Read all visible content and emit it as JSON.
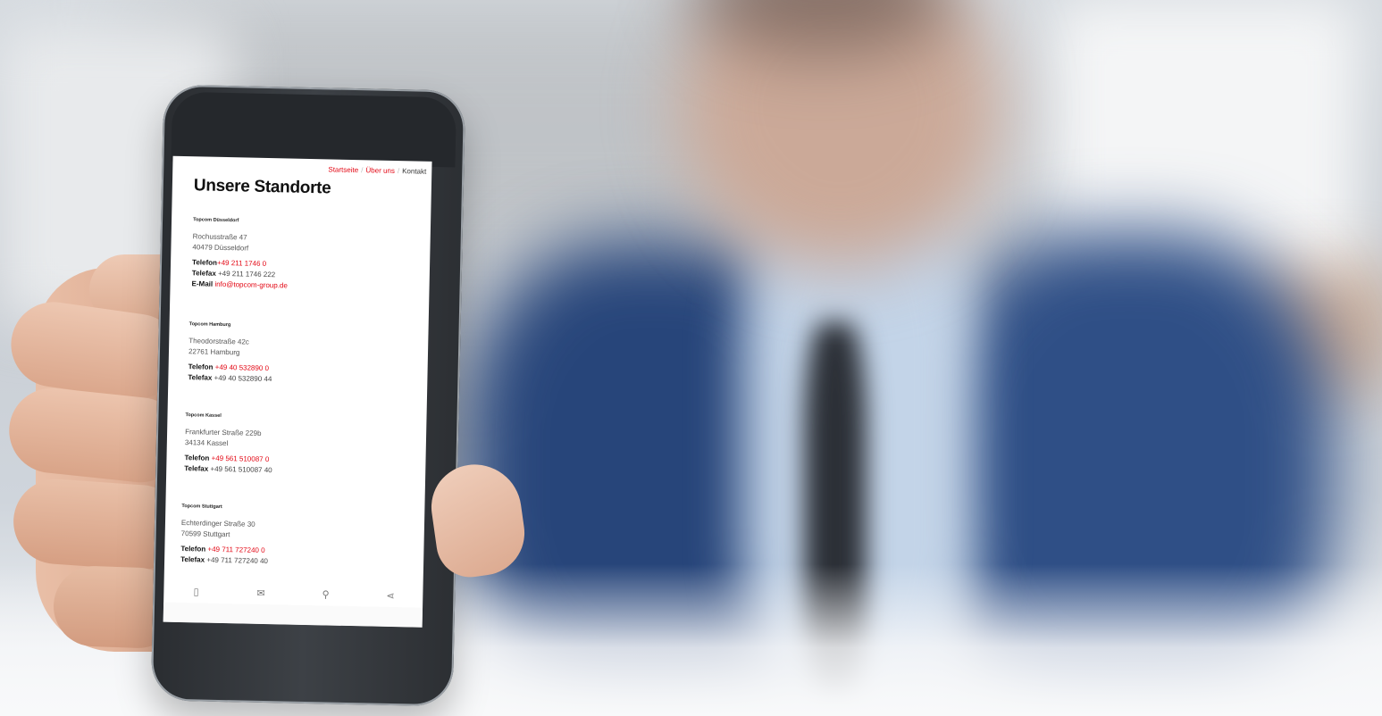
{
  "breadcrumb": {
    "items": [
      "Startseite",
      "Über uns",
      "Kontakt"
    ],
    "separator": "/"
  },
  "page_title": "Unsere Standorte",
  "labels": {
    "phone": "Telefon",
    "fax": "Telefax",
    "email": "E-Mail"
  },
  "locations": [
    {
      "name": "Topcom Düsseldorf",
      "street": "Rochusstraße 47",
      "city": "40479 Düsseldorf",
      "phone": "+49 211 1746 0",
      "fax": "+49 211 1746 222",
      "email": "info@topcom-group.de"
    },
    {
      "name": "Topcom Hamburg",
      "street": "Theodorstraße 42c",
      "city": "22761 Hamburg",
      "phone": "+49 40 532890 0",
      "fax": "+49 40 532890 44"
    },
    {
      "name": "Topcom Kassel",
      "street": "Frankfurter Straße 229b",
      "city": "34134 Kassel",
      "phone": "+49 561 510087 0",
      "fax": "+49 561 510087 40"
    },
    {
      "name": "Topcom Stuttgart",
      "street": "Echterdinger Straße 30",
      "city": "70599 Stuttgart",
      "phone": "+49 711 727240 0",
      "fax": "+49 711 727240 40"
    }
  ],
  "tabbar_icons": [
    "phone-icon",
    "mail-icon",
    "location-pin-icon",
    "share-icon"
  ],
  "colors": {
    "accent": "#e30613",
    "text": "#111111"
  }
}
